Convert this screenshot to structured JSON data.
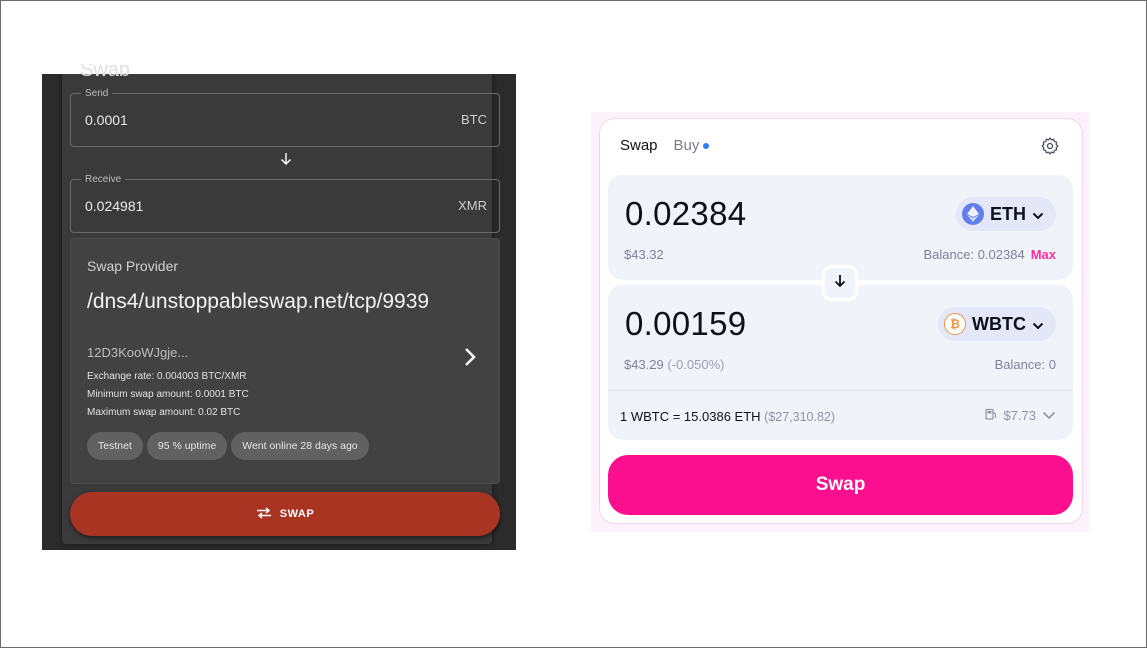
{
  "left_panel": {
    "heading_peek": "Swap",
    "send": {
      "legend": "Send",
      "value": "0.0001",
      "unit": "BTC"
    },
    "receive": {
      "legend": "Receive",
      "value": "0.024981",
      "unit": "XMR"
    },
    "arrow_icon": "arrow-down-icon",
    "provider": {
      "title": "Swap Provider",
      "address": "/dns4/unstoppableswap.net/tcp/9939",
      "peer_id": "12D3KooWJgje...",
      "exchange_rate": "Exchange rate: 0.004003 BTC/XMR",
      "min_amount": "Minimum swap amount: 0.0001 BTC",
      "max_amount": "Maximum swap amount: 0.02 BTC",
      "chips": [
        "Testnet",
        "95 % uptime",
        "Went online 28 days ago"
      ]
    },
    "swap_button": "SWAP",
    "colors": {
      "panel": "#3a3a3a",
      "button": "#a93422"
    }
  },
  "right_panel": {
    "tabs": {
      "swap": "Swap",
      "buy": "Buy"
    },
    "from": {
      "amount": "0.02384",
      "usd": "$43.32",
      "token": "ETH",
      "balance": "Balance: 0.02384",
      "max": "Max"
    },
    "to": {
      "amount": "0.00159",
      "usd": "$43.29",
      "usd_change": "(-0.050%)",
      "token": "WBTC",
      "balance": "Balance: 0"
    },
    "rate": {
      "text": "1 WBTC = 15.0386 ETH",
      "usd": "($27,310.82)"
    },
    "gas": "$7.73",
    "swap_button": "Swap",
    "colors": {
      "accent": "#fc0f8e",
      "panel": "#f1f3fb"
    }
  }
}
